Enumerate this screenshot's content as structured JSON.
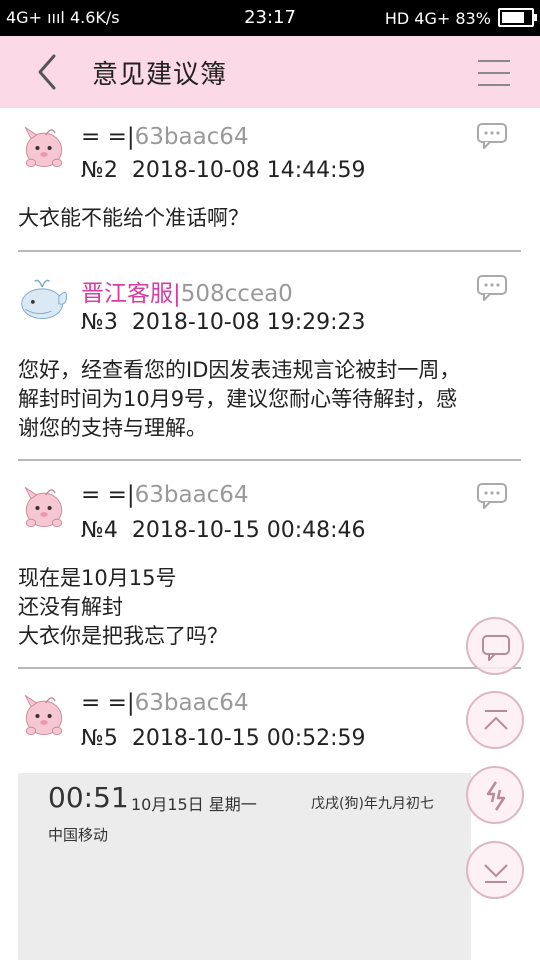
{
  "status_bar": {
    "left": "4G+ ıııl  4.6K/s",
    "time": "23:17",
    "right": "HD 4G+ 83%",
    "battery_level": 0.83
  },
  "header": {
    "title": "意见建议簿"
  },
  "posts": [
    {
      "username": "= =",
      "separator": "|",
      "user_id": "63baac64",
      "floor": "№2",
      "timestamp": "2018-10-08 14:44:59",
      "lines": [
        "大衣能不能给个准话啊？"
      ]
    },
    {
      "username": "晋江客服",
      "separator": "|",
      "user_id": "508ccea0",
      "floor": "№3",
      "timestamp": "2018-10-08 19:29:23",
      "lines": [
        "您好，经查看您的ID因发表违规言论被封一周，",
        "解封时间为10月9号，建议您耐心等待解封，感",
        "谢您的支持与理解。"
      ]
    },
    {
      "username": "= =",
      "separator": "|",
      "user_id": "63baac64",
      "floor": "№4",
      "timestamp": "2018-10-15 00:48:46",
      "lines": [
        "现在是10月15号",
        "还没有解封",
        "大衣你是把我忘了吗？"
      ]
    },
    {
      "username": "= =",
      "separator": "|",
      "user_id": "63baac64",
      "floor": "№5",
      "timestamp": "2018-10-15 00:52:59",
      "lines": []
    }
  ],
  "embedded_screenshot": {
    "clock": "00:51",
    "date": "10月15日 星期一",
    "lunar": "戊戌(狗)年九月初七",
    "carrier": "中国移动"
  },
  "icons": {
    "back": "chevron-left-icon",
    "menu": "hamburger-menu-icon",
    "reply": "comment-bubble-icon",
    "float_comment": "comment-icon",
    "float_top": "scroll-to-top-icon",
    "float_refresh": "refresh-icon",
    "float_bottom": "scroll-to-bottom-icon"
  },
  "colors": {
    "header_bg": "#fbd9e6",
    "staff_name": "#d63fa0",
    "float_border": "#ddb6c3"
  }
}
